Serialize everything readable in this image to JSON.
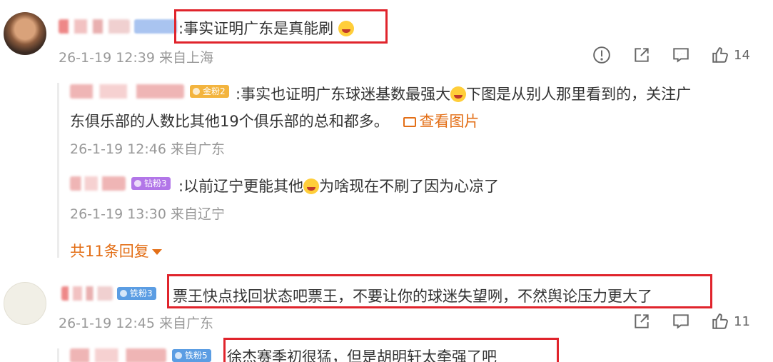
{
  "comments": [
    {
      "text": ":事实证明广东是真能刷",
      "meta": "26-1-19 12:39 来自上海",
      "like_count": "14"
    },
    {
      "text": "票王快点找回状态吧票王，不要让你的球迷失望咧，不然舆论压力更大了",
      "meta": "26-1-19 12:45 来自广东",
      "like_count": "11",
      "badge": "铁粉3"
    },
    {
      "text": "徐杰赛季初很猛，但是胡明轩太牵强了吧",
      "badge": "铁粉5"
    }
  ],
  "replies": [
    {
      "badge": "金粉2",
      "text_line1": ":事实也证明广东球迷基数最强大",
      "text_line1b": "下图是从别人那里看到的，关注广",
      "text_line2": "东俱乐部的人数比其他19个俱乐部的总和都多。",
      "view_image": "查看图片",
      "meta": "26-1-19 12:46 来自广东"
    },
    {
      "badge": "钻粉3",
      "text_a": ":以前辽宁更能其他",
      "text_b": "为啥现在不刷了因为心凉了",
      "meta": "26-1-19 13:30 来自辽宁"
    }
  ],
  "more_replies": "共11条回复",
  "colors": {
    "accent": "#e36f17",
    "highlight_box": "#e0242c"
  },
  "icons": [
    "report-icon",
    "share-icon",
    "comment-icon",
    "like-icon"
  ]
}
